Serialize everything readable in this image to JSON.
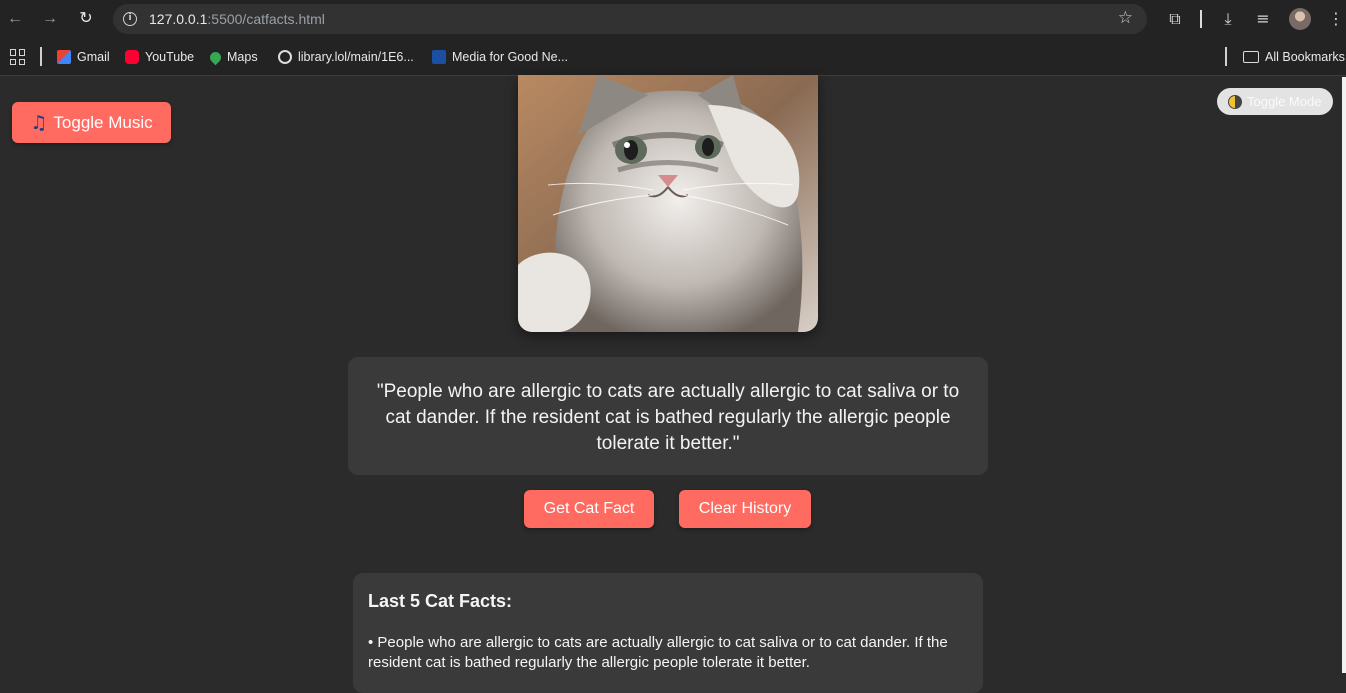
{
  "browser": {
    "url_host": "127.0.0.1",
    "url_path": ":5500/catfacts.html",
    "bookmarks": [
      {
        "label": "Gmail",
        "icon": "gmail-icon",
        "color": "#ea4335"
      },
      {
        "label": "YouTube",
        "icon": "youtube-icon",
        "color": "#ff0033"
      },
      {
        "label": "Maps",
        "icon": "maps-icon",
        "color": "#34a853"
      },
      {
        "label": "library.lol/main/1E6...",
        "icon": "globe-icon",
        "color": "#dcdcdc"
      },
      {
        "label": "Media for Good Ne...",
        "icon": "media-icon",
        "color": "#1a4fa3"
      }
    ],
    "all_bookmarks": "All Bookmarks"
  },
  "page": {
    "music_button": "Toggle Music",
    "mode_button": "Toggle Mode",
    "accent_color": "#ff6b61",
    "current_fact": "\"People who are allergic to cats are actually allergic to cat saliva or to cat dander. If the resident cat is bathed regularly the allergic people tolerate it better.\"",
    "get_fact_button": "Get Cat Fact",
    "clear_history_button": "Clear History",
    "history": {
      "title": "Last 5 Cat Facts:",
      "items": [
        "• People who are allergic to cats are actually allergic to cat saliva or to cat dander. If the resident cat is bathed regularly the allergic people tolerate it better."
      ]
    }
  }
}
